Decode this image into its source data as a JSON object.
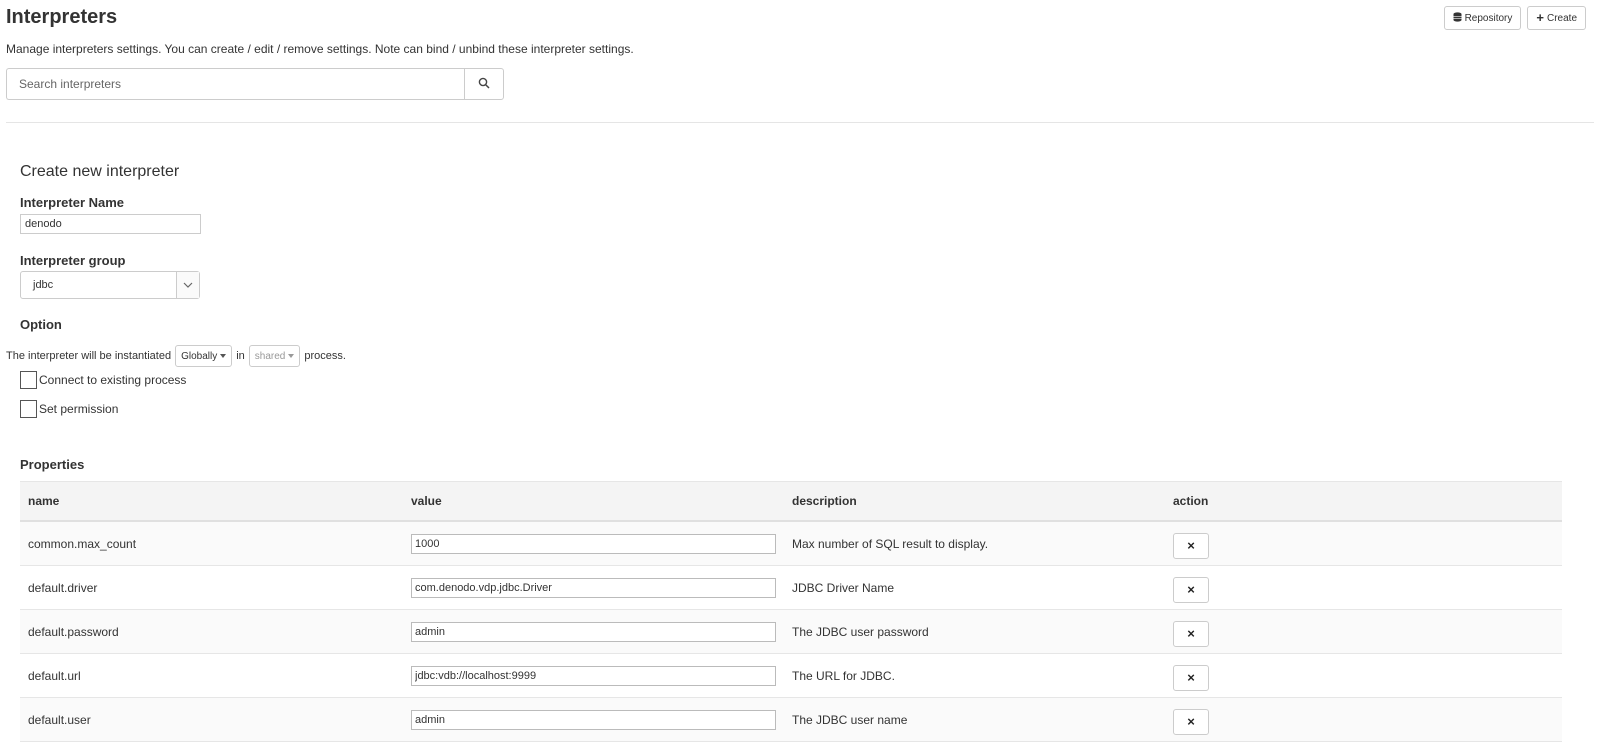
{
  "header": {
    "title": "Interpreters",
    "subtitle": "Manage interpreters settings. You can create / edit / remove settings. Note can bind / unbind these interpreter settings.",
    "repository_label": "Repository",
    "create_label": "Create"
  },
  "search": {
    "placeholder": "Search interpreters",
    "value": ""
  },
  "form": {
    "section_title": "Create new interpreter",
    "name_label": "Interpreter Name",
    "name_value": "denodo",
    "group_label": "Interpreter group",
    "group_value": "jdbc",
    "option_label": "Option",
    "option_prefix": "The interpreter will be instantiated",
    "scope_value": "Globally",
    "in_text": "in",
    "process_mode_value": "shared",
    "process_suffix": "process.",
    "connect_existing_label": "Connect to existing process",
    "set_permission_label": "Set permission"
  },
  "properties": {
    "label": "Properties",
    "columns": [
      "name",
      "value",
      "description",
      "action"
    ],
    "rows": [
      {
        "name": "common.max_count",
        "value": "1000",
        "description": "Max number of SQL result to display."
      },
      {
        "name": "default.driver",
        "value": "com.denodo.vdp.jdbc.Driver",
        "description": "JDBC Driver Name"
      },
      {
        "name": "default.password",
        "value": "admin",
        "description": "The JDBC user password"
      },
      {
        "name": "default.url",
        "value": "jdbc:vdb://localhost:9999",
        "description": "The URL for JDBC."
      },
      {
        "name": "default.user",
        "value": "admin",
        "description": "The JDBC user name"
      }
    ],
    "delete_icon": "×"
  }
}
